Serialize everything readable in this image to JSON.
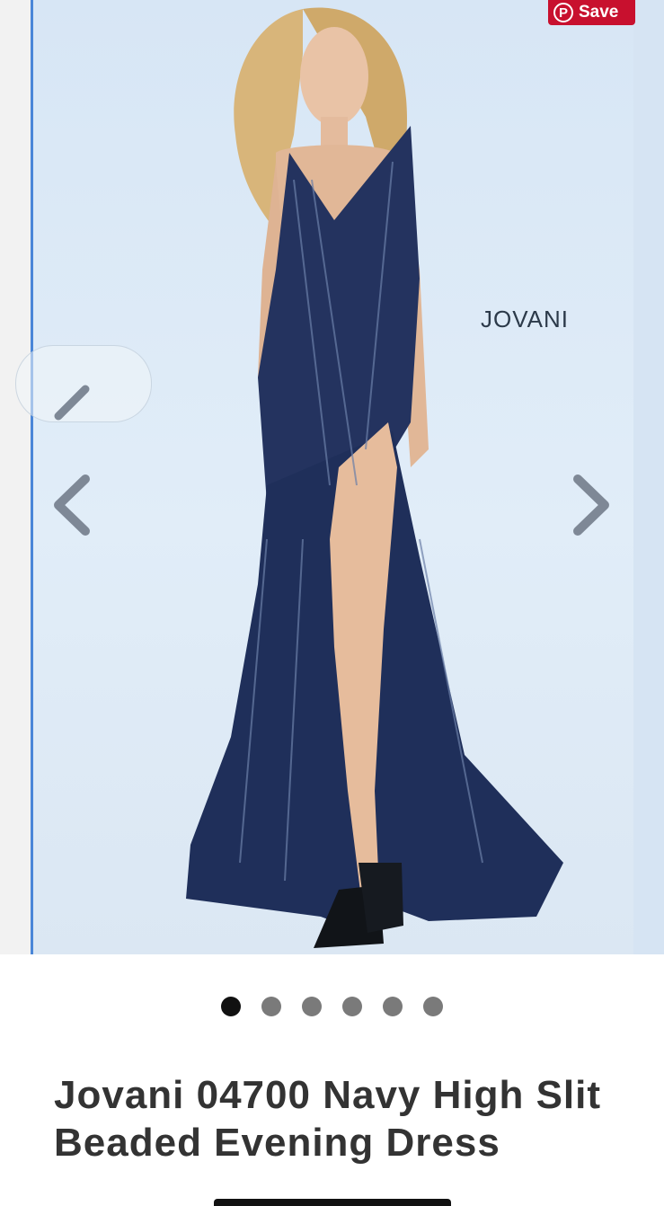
{
  "gallery": {
    "brand_mark": "JOVANI",
    "save_label": "Save",
    "pinterest_icon": "pinterest-icon",
    "prev_icon": "chevron-left-icon",
    "next_icon": "chevron-right-icon",
    "slide_count": 6,
    "active_slide": 1
  },
  "product": {
    "title": "Jovani 04700 Navy High Slit Beaded Evening Dress"
  },
  "colors": {
    "photo_bg": "#dde9f5",
    "dress_navy": "#1f2f5a",
    "save_red": "#c8102e",
    "accent_blue": "#4a86d8"
  }
}
